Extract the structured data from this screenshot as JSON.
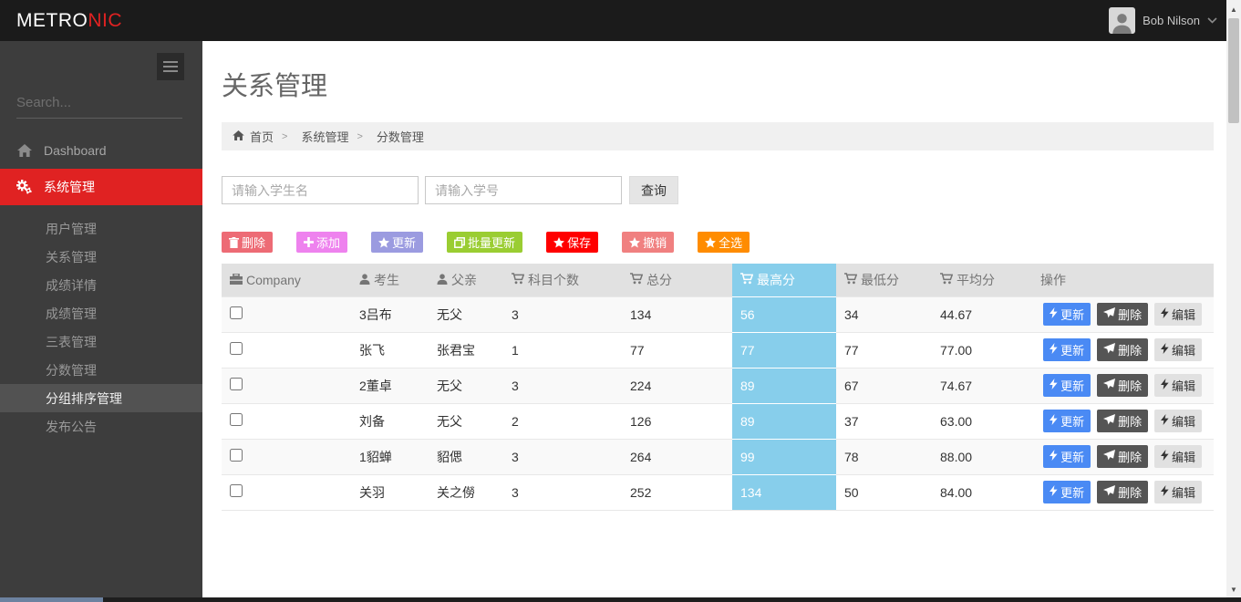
{
  "colors": {
    "accent_red": "#e02222",
    "highlight_blue": "#87ceeb"
  },
  "topbar": {
    "brand_part1": "METRO",
    "brand_part2": "NIC",
    "user_name": "Bob Nilson"
  },
  "sidebar": {
    "search_placeholder": "Search...",
    "items": [
      {
        "label": "Dashboard",
        "icon": "home-icon",
        "active": false
      },
      {
        "label": "系统管理",
        "icon": "gears-icon",
        "active": true
      }
    ],
    "submenu": [
      {
        "label": "用户管理",
        "active": false
      },
      {
        "label": "关系管理",
        "active": false
      },
      {
        "label": "成绩详情",
        "active": false
      },
      {
        "label": "成绩管理",
        "active": false
      },
      {
        "label": "三表管理",
        "active": false
      },
      {
        "label": "分数管理",
        "active": false
      },
      {
        "label": "分组排序管理",
        "active": true
      },
      {
        "label": "发布公告",
        "active": false
      }
    ]
  },
  "page": {
    "title": "关系管理",
    "breadcrumb": [
      {
        "label": "首页",
        "icon": "home-icon"
      },
      {
        "label": "系统管理"
      },
      {
        "label": "分数管理"
      }
    ]
  },
  "filters": {
    "student_name_placeholder": "请输入学生名",
    "student_no_placeholder": "请输入学号",
    "query_label": "查询"
  },
  "toolbar": {
    "buttons": [
      {
        "label": "删除",
        "icon": "trash-icon",
        "color": "#ed6b75"
      },
      {
        "label": "添加",
        "icon": "plus-icon",
        "color": "#ee82ee"
      },
      {
        "label": "更新",
        "icon": "star-icon",
        "color": "#9b9be0"
      },
      {
        "label": "批量更新",
        "icon": "clone-icon",
        "color": "#9acd32"
      },
      {
        "label": "保存",
        "icon": "star-icon",
        "color": "#ff0000"
      },
      {
        "label": "撤销",
        "icon": "star-icon",
        "color": "#f08080"
      },
      {
        "label": "全选",
        "icon": "star-icon",
        "color": "#ff8c00"
      }
    ]
  },
  "table": {
    "columns": [
      {
        "label": "Company",
        "icon": "briefcase-icon",
        "highlight": false
      },
      {
        "label": "考生",
        "icon": "user-icon",
        "highlight": false
      },
      {
        "label": "父亲",
        "icon": "user-icon",
        "highlight": false
      },
      {
        "label": "科目个数",
        "icon": "cart-icon",
        "highlight": false
      },
      {
        "label": "总分",
        "icon": "cart-icon",
        "highlight": false
      },
      {
        "label": "最高分",
        "icon": "cart-icon",
        "highlight": true
      },
      {
        "label": "最低分",
        "icon": "cart-icon",
        "highlight": false
      },
      {
        "label": "平均分",
        "icon": "cart-icon",
        "highlight": false
      },
      {
        "label": "操作",
        "icon": "",
        "highlight": false
      }
    ],
    "rows": [
      {
        "company": "",
        "student": "3吕布",
        "father": "无父",
        "subjects": "3",
        "total": "134",
        "max": "56",
        "min": "34",
        "avg": "44.67"
      },
      {
        "company": "",
        "student": "张飞",
        "father": "张君宝",
        "subjects": "1",
        "total": "77",
        "max": "77",
        "min": "77",
        "avg": "77.00"
      },
      {
        "company": "",
        "student": "2董卓",
        "father": "无父",
        "subjects": "3",
        "total": "224",
        "max": "89",
        "min": "67",
        "avg": "74.67"
      },
      {
        "company": "",
        "student": "刘备",
        "father": "无父",
        "subjects": "2",
        "total": "126",
        "max": "89",
        "min": "37",
        "avg": "63.00"
      },
      {
        "company": "",
        "student": "1貂蝉",
        "father": "貂偲",
        "subjects": "3",
        "total": "264",
        "max": "99",
        "min": "78",
        "avg": "88.00"
      },
      {
        "company": "",
        "student": "关羽",
        "father": "关之僗",
        "subjects": "3",
        "total": "252",
        "max": "134",
        "min": "50",
        "avg": "84.00"
      }
    ],
    "row_actions": [
      {
        "label": "更新",
        "icon": "bolt-icon"
      },
      {
        "label": "删除",
        "icon": "plane-icon"
      },
      {
        "label": "编辑",
        "icon": "bolt-icon"
      }
    ]
  }
}
